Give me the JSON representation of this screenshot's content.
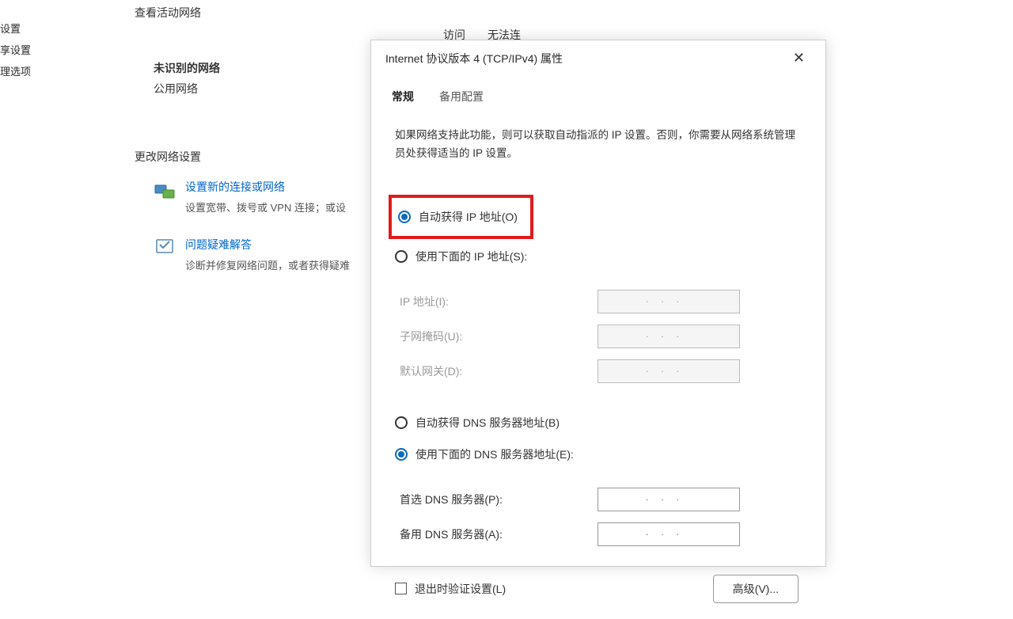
{
  "leftNav": {
    "item1": "设置",
    "item2": "享设置",
    "item3": "理选项"
  },
  "background": {
    "activeNetworksTitle": "查看活动网络",
    "unknownNetwork": "未识别的网络",
    "publicNetwork": "公用网络",
    "accessTypeLabel": "访问类型：",
    "accessTypeValue": "无法连接到 Internet",
    "changeSettingsTitle": "更改网络设置",
    "option1": {
      "link": "设置新的连接或网络",
      "desc": "设置宽带、拨号或 VPN 连接；或设"
    },
    "option2": {
      "link": "问题疑难解答",
      "desc": "诊断并修复网络问题，或者获得疑难"
    }
  },
  "dialog": {
    "title": "Internet 协议版本 4 (TCP/IPv4) 属性",
    "tabs": {
      "general": "常规",
      "alternate": "备用配置"
    },
    "infoText": "如果网络支持此功能，则可以获取自动指派的 IP 设置。否则，你需要从网络系统管理员处获得适当的 IP 设置。",
    "ipSection": {
      "autoIp": "自动获得 IP 地址(O)",
      "manualIp": "使用下面的 IP 地址(S):",
      "ipAddress": "IP 地址(I):",
      "subnetMask": "子网掩码(U):",
      "gateway": "默认网关(D):"
    },
    "dnsSection": {
      "autoDns": "自动获得 DNS 服务器地址(B)",
      "manualDns": "使用下面的 DNS 服务器地址(E):",
      "preferredDns": "首选 DNS 服务器(P):",
      "alternateDns": "备用 DNS 服务器(A):"
    },
    "validateOnExit": "退出时验证设置(L)",
    "advancedBtn": "高级(V)..."
  }
}
